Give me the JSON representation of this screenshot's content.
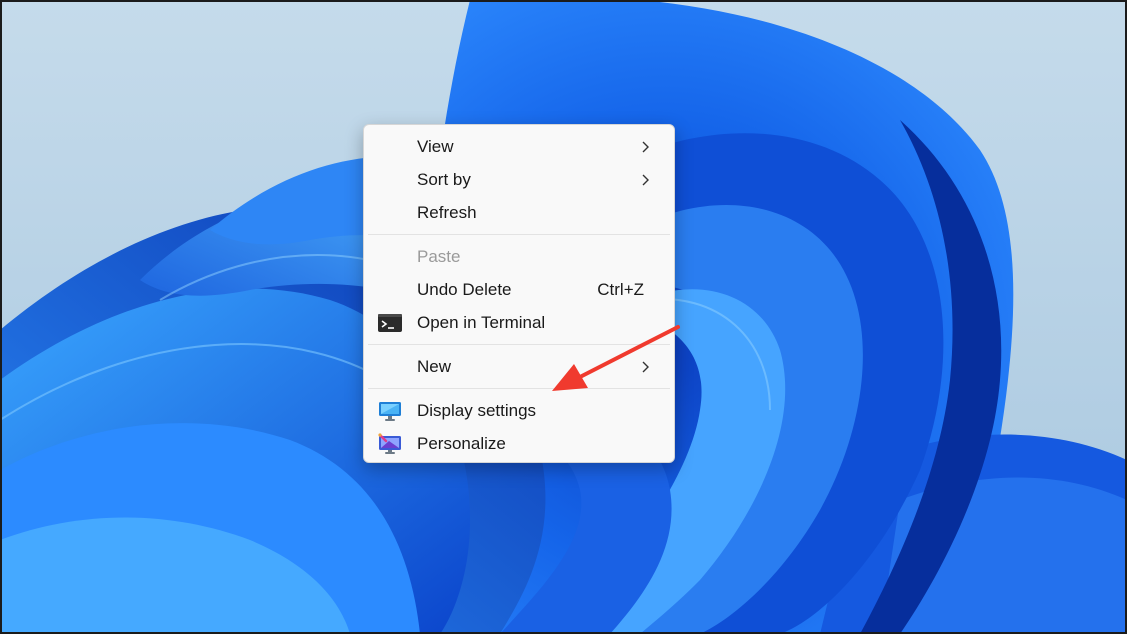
{
  "desktop": {
    "wallpaper": "windows-11-bloom-wallpaper",
    "colors": {
      "sky": "#b9d3e6",
      "bloom_dark": "#0a3fc4",
      "bloom_mid": "#1a6ef0",
      "bloom_light": "#3ea2ff",
      "annotation_arrow": "#f03a2e"
    }
  },
  "context_menu": {
    "items": [
      {
        "label": "View",
        "has_submenu": true,
        "icon": null
      },
      {
        "label": "Sort by",
        "has_submenu": true,
        "icon": null
      },
      {
        "label": "Refresh",
        "has_submenu": false,
        "icon": null
      },
      {
        "label": "Paste",
        "disabled": true,
        "icon": null
      },
      {
        "label": "Undo Delete",
        "shortcut": "Ctrl+Z",
        "icon": null
      },
      {
        "label": "Open in Terminal",
        "icon": "terminal-icon"
      },
      {
        "label": "New",
        "has_submenu": true,
        "icon": null
      },
      {
        "label": "Display settings",
        "icon": "monitor-icon"
      },
      {
        "label": "Personalize",
        "icon": "personalize-icon"
      }
    ]
  },
  "annotation": {
    "type": "red-arrow",
    "points_to": "Display settings"
  }
}
